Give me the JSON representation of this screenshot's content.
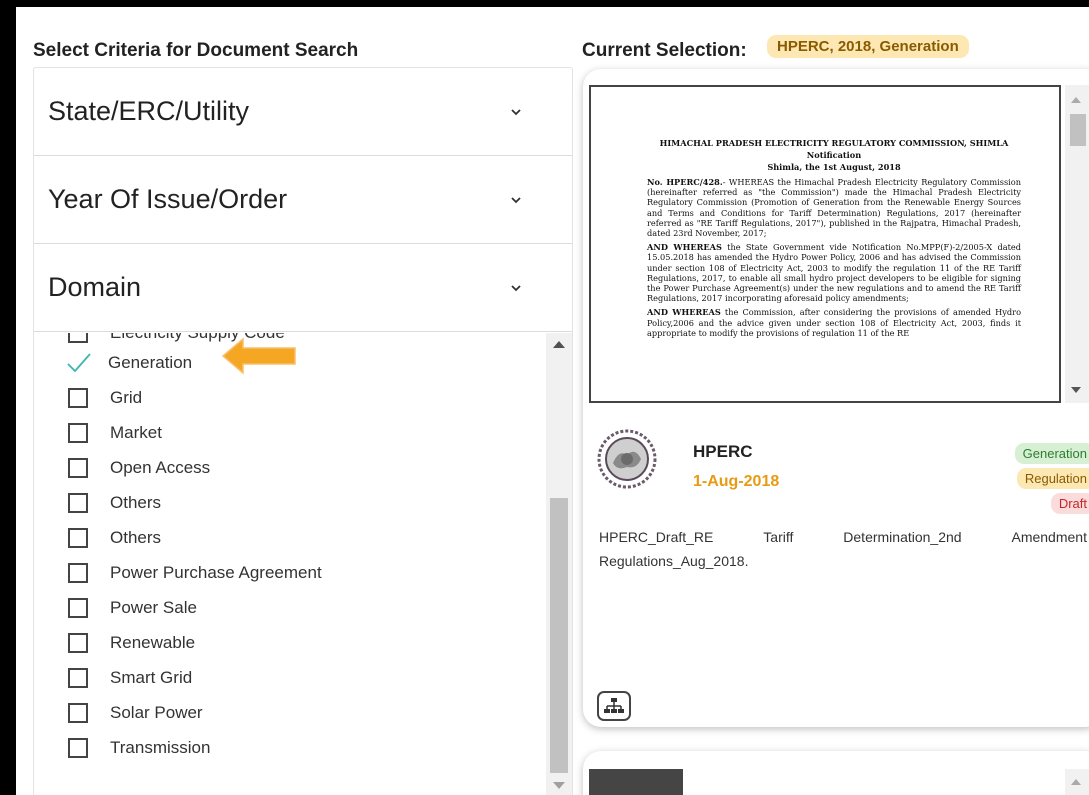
{
  "left_panel": {
    "title": "Select Criteria for Document Search",
    "accordions": [
      {
        "label": "State/ERC/Utility"
      },
      {
        "label": "Year Of Issue/Order"
      },
      {
        "label": "Domain"
      }
    ],
    "partial_option": "Electricity Supply Code",
    "options": [
      {
        "label": "Generation",
        "checked": true
      },
      {
        "label": "Grid",
        "checked": false
      },
      {
        "label": "Market",
        "checked": false
      },
      {
        "label": "Open Access",
        "checked": false
      },
      {
        "label": "Others",
        "checked": false
      },
      {
        "label": "Others",
        "checked": false
      },
      {
        "label": "Power Purchase Agreement",
        "checked": false
      },
      {
        "label": "Power Sale",
        "checked": false
      },
      {
        "label": "Renewable",
        "checked": false
      },
      {
        "label": "Smart Grid",
        "checked": false
      },
      {
        "label": "Solar Power",
        "checked": false
      },
      {
        "label": "Transmission",
        "checked": false
      }
    ]
  },
  "right_panel": {
    "title": "Current Selection:",
    "selection_badge": "HPERC, 2018, Generation",
    "result": {
      "preview": {
        "heading1": "HIMACHAL PRADESH ELECTRICITY REGULATORY COMMISSION, SHIMLA",
        "heading2": "Notification",
        "heading3": "Shimla, the  1st August, 2018",
        "para1_bold": "No. HPERC/428.",
        "para1": "- WHEREAS the Himachal Pradesh Electricity Regulatory Commission (hereinafter referred as \"the Commission\") made the Himachal Pradesh Electricity Regulatory Commission (Promotion of Generation from the Renewable Energy Sources and Terms and Conditions for Tariff Determination) Regulations, 2017 (hereinafter referred as \"RE Tariff Regulations, 2017\"), published in the Rajpatra, Himachal Pradesh, dated 23rd November, 2017;",
        "para2_bold": "AND WHEREAS",
        "para2": " the State Government vide Notification No.MPP(F)-2/2005-X dated 15.05.2018 has amended the Hydro Power Policy, 2006 and has advised the Commission under section 108 of Electricity Act, 2003 to modify the regulation 11 of the RE Tariff Regulations, 2017, to enable all small hydro project developers to be eligible for signing the Power Purchase Agreement(s) under the new regulations and to amend the RE Tariff Regulations, 2017 incorporating aforesaid policy amendments;",
        "para3_bold": "AND WHEREAS",
        "para3": " the Commission, after considering the provisions of amended Hydro Policy,2006 and the advice given under section 108 of Electricity Act, 2003, finds it appropriate to modify the provisions of regulation 11 of the RE"
      },
      "org": "HPERC",
      "date": "1-Aug-2018",
      "tags": [
        "Generation",
        "Regulation",
        "Draft"
      ],
      "description_line1": [
        "HPERC_Draft_RE",
        "Tariff",
        "Determination_2nd",
        "Amendment"
      ],
      "description_line2": "Regulations_Aug_2018.",
      "org_icon": "org-chart-icon"
    }
  },
  "colors": {
    "check": "#3fb6b0",
    "arrow": "#f5a623",
    "date": "#e89b12"
  }
}
